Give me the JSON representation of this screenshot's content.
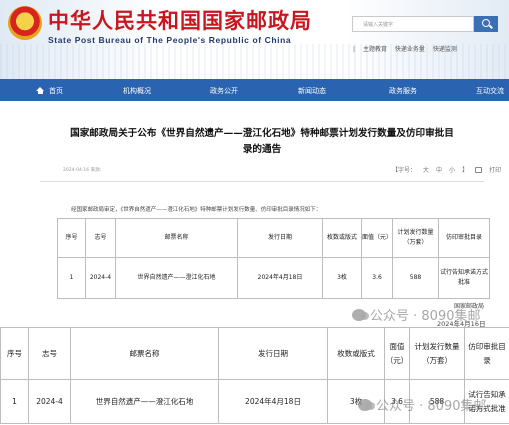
{
  "header": {
    "title": "中华人民共和国国家邮政局",
    "subtitle": "State Post Bureau of The People's Republic of China",
    "search_placeholder": "请输入关键字",
    "top_links": [
      "|",
      "主题教育",
      "快递业务量",
      "快递监测"
    ]
  },
  "nav": {
    "items": [
      "首页",
      "机构概况",
      "政务公开",
      "新闻动态",
      "政务服务",
      "互动交流"
    ]
  },
  "article": {
    "title_line1": "国家邮政局关于公布《世界自然遗产——澄江化石地》特种邮票计划发行数量及仿印审批目",
    "title_line2": "录的通告",
    "meta": "2024-04-16 来源：",
    "tools": {
      "font_size": "【字号：",
      "large": "大",
      "medium": "中",
      "small": "小",
      "close_bracket": "】",
      "print": "打印"
    },
    "intro": "经国家邮政局审定，《世界自然遗产——澄江化石地》特种邮票计划发行数量、仿印审批目录情况如下：",
    "table": {
      "headers": [
        "序号",
        "志号",
        "邮票名称",
        "发行日期",
        "枚数或版式",
        "面值（元）",
        "计划发行数量（万套）",
        "仿印审批目录"
      ],
      "rows": [
        [
          "1",
          "2024-4",
          "世界自然遗产——澄江化石地",
          "2024年4月18日",
          "3枚",
          "3.6",
          "588",
          "试行告知承诺方式批准"
        ]
      ]
    },
    "sign": "国家邮政局",
    "date": "2024年4月16日"
  },
  "enlarged_table": {
    "headers": [
      "序号",
      "志号",
      "邮票名称",
      "发行日期",
      "枚数或版式",
      "面值（元）",
      "计划发行数量（万套）",
      "仿印审批目录"
    ],
    "rows": [
      [
        "1",
        "2024-4",
        "世界自然遗产——澄江化石地",
        "2024年4月18日",
        "3枚",
        "3.6",
        "588",
        "试行告知承诺方式批准"
      ]
    ]
  },
  "watermark": {
    "text1": "公众号 · 8090集邮",
    "text2": "公众号 · 8090集邮"
  }
}
